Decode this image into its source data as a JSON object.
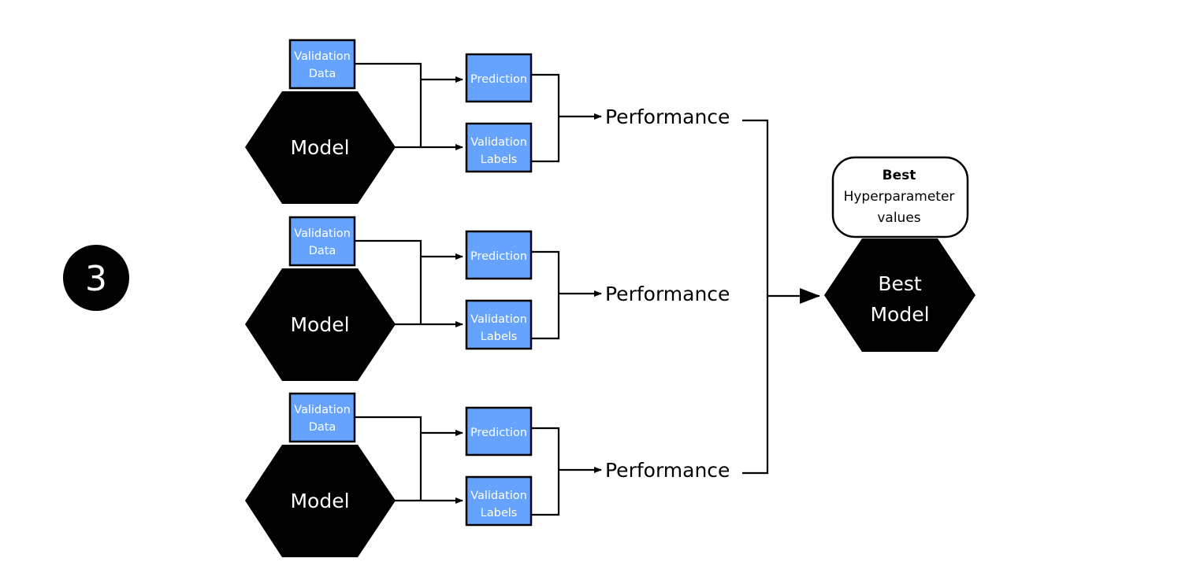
{
  "step": {
    "number": "3"
  },
  "pipelines": [
    {
      "model_label": "Model",
      "validation_data": [
        "Validation",
        "Data"
      ],
      "prediction": "Prediction",
      "validation_labels": [
        "Validation",
        "Labels"
      ],
      "performance": "Performance"
    },
    {
      "model_label": "Model",
      "validation_data": [
        "Validation",
        "Data"
      ],
      "prediction": "Prediction",
      "validation_labels": [
        "Validation",
        "Labels"
      ],
      "performance": "Performance"
    },
    {
      "model_label": "Model",
      "validation_data": [
        "Validation",
        "Data"
      ],
      "prediction": "Prediction",
      "validation_labels": [
        "Validation",
        "Labels"
      ],
      "performance": "Performance"
    }
  ],
  "best": {
    "hyperparameters": [
      "Best",
      "Hyperparameter",
      "values"
    ],
    "model": [
      "Best",
      "Model"
    ]
  },
  "colors": {
    "box_fill": "#66a3ff",
    "node_fill": "#000000"
  }
}
